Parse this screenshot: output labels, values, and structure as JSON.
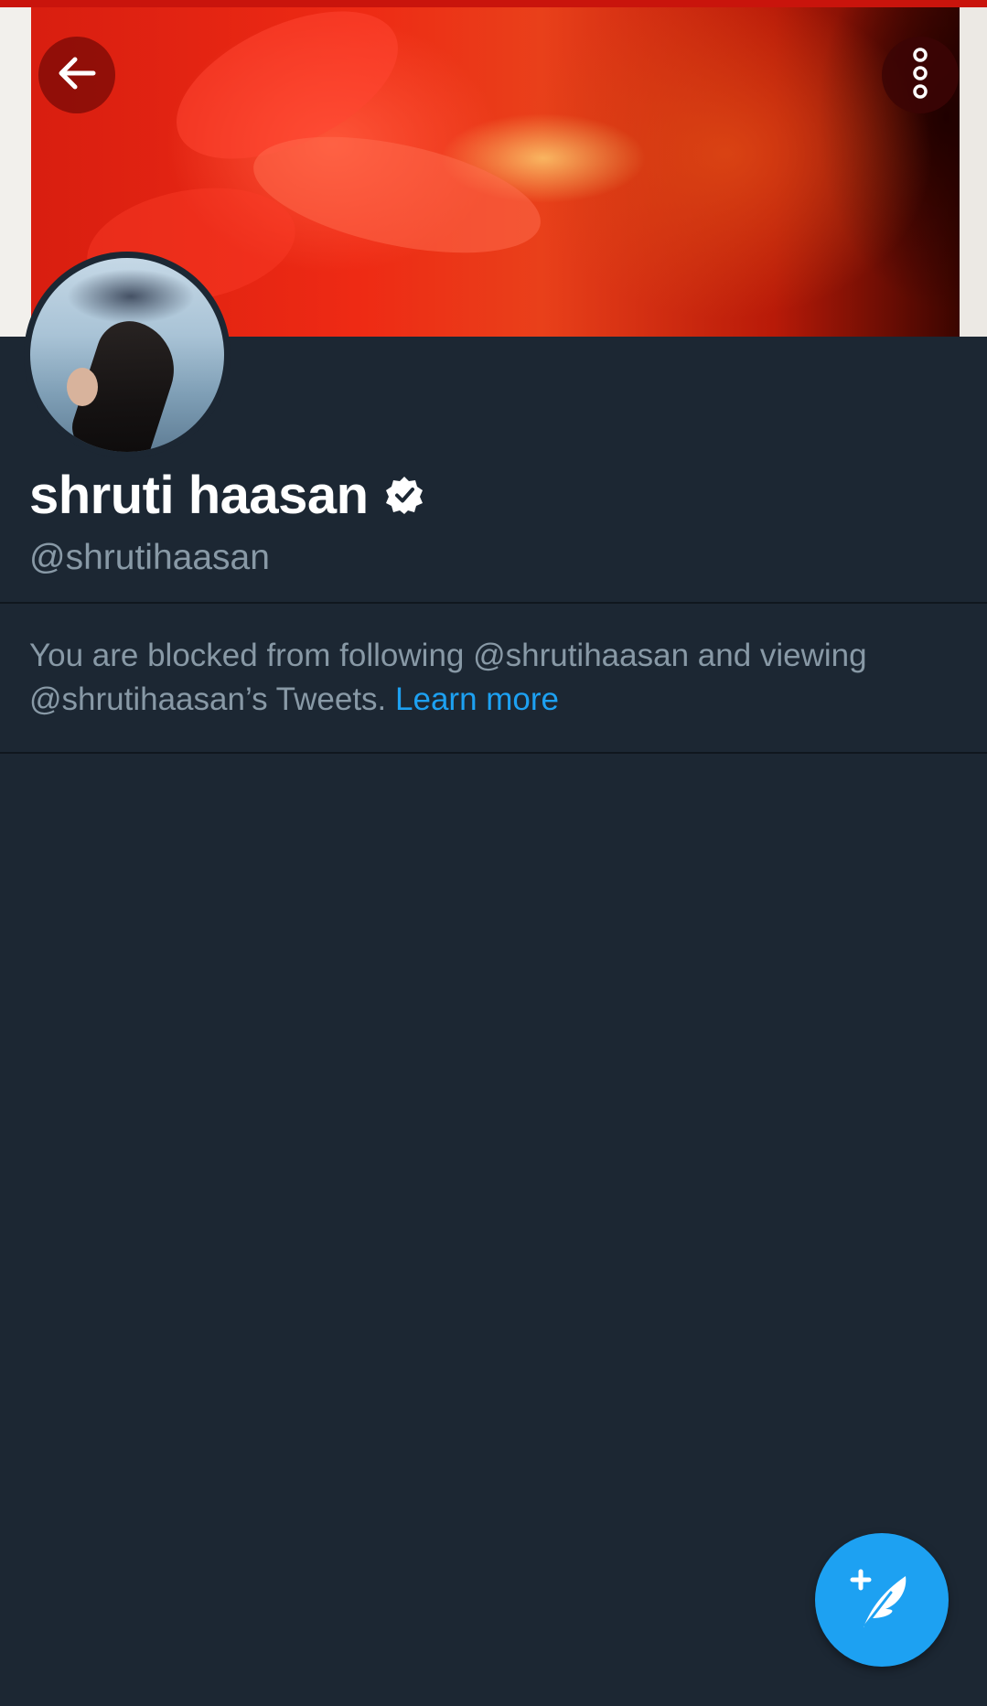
{
  "profile": {
    "display_name": "shruti haasan",
    "handle": "@shrutihaasan",
    "verified": true
  },
  "notice": {
    "text": "You are blocked from following @shrutihaasan and viewing @shrutihaasan’s Tweets. ",
    "link_label": "Learn more"
  },
  "icons": {
    "back": "arrow-left-icon",
    "more": "more-vertical-icon",
    "verified": "verified-badge-icon",
    "compose": "compose-tweet-icon"
  },
  "colors": {
    "background": "#1c2733",
    "accent": "#1da1f2",
    "secondary_text": "#8899a6"
  }
}
